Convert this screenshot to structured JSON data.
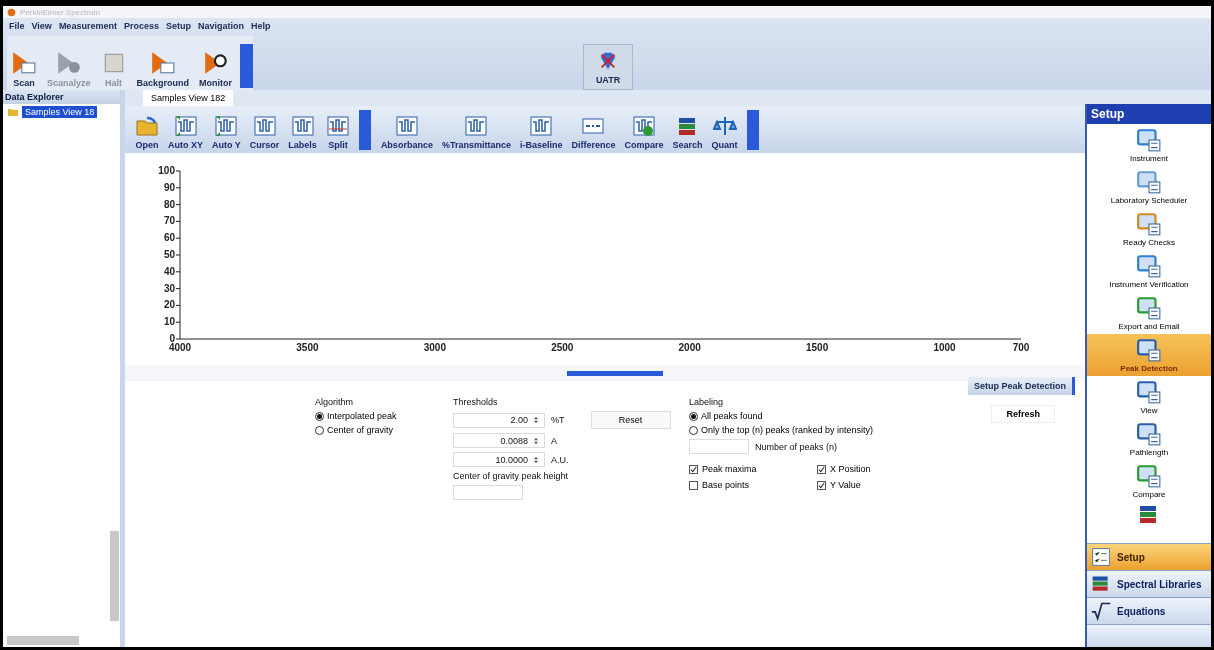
{
  "window": {
    "title": "PerkinElmer Spectrum"
  },
  "menu": [
    "File",
    "View",
    "Measurement",
    "Process",
    "Setup",
    "Navigation",
    "Help"
  ],
  "ribbon": {
    "buttons": [
      {
        "label": "Scan",
        "disabled": false
      },
      {
        "label": "Scanalyze",
        "disabled": true
      },
      {
        "label": "Halt",
        "disabled": true
      },
      {
        "label": "Background",
        "disabled": false
      },
      {
        "label": "Monitor",
        "disabled": false
      }
    ],
    "accessory": "UATR"
  },
  "data_explorer": {
    "title": "Data Explorer",
    "items": [
      {
        "label": "Samples View 18",
        "selected": true
      }
    ]
  },
  "tabs": [
    {
      "label": "Samples View 182",
      "selected": true
    }
  ],
  "toolbar": {
    "groups": [
      [
        "Open",
        "Auto XY",
        "Auto Y",
        "Cursor",
        "Labels",
        "Split"
      ],
      [
        "Absorbance",
        "%Transmittance",
        "i-Baseline",
        "Difference",
        "Compare",
        "Search",
        "Quant"
      ]
    ]
  },
  "chart_data": {
    "type": "line",
    "xlim": [
      4000,
      700
    ],
    "ylim": [
      0,
      100
    ],
    "xticks": [
      4000,
      3500,
      3000,
      2500,
      2000,
      1500,
      1000,
      700
    ],
    "yticks": [
      0,
      10,
      20,
      30,
      40,
      50,
      60,
      70,
      80,
      90,
      100
    ]
  },
  "peak_detection": {
    "algorithm": {
      "label": "Algorithm",
      "options": [
        {
          "label": "Interpolated peak",
          "selected": true
        },
        {
          "label": "Center of gravity",
          "selected": false
        }
      ]
    },
    "thresholds": {
      "label": "Thresholds",
      "fields": [
        {
          "value": "2.00",
          "unit": "%T"
        },
        {
          "value": "0.0088",
          "unit": "A"
        },
        {
          "value": "10.0000",
          "unit": "A.U."
        }
      ],
      "reset": "Reset",
      "gravity_label": "Center of gravity peak height"
    },
    "labeling": {
      "label": "Labeling",
      "options": [
        {
          "label": "All peaks found",
          "selected": true
        },
        {
          "label": "Only the top (n) peaks (ranked by intensity)",
          "selected": false
        }
      ],
      "count_label": "Number of peaks (n)",
      "checkboxes": [
        {
          "label": "Peak maxima",
          "checked": true
        },
        {
          "label": "X Position",
          "checked": true
        },
        {
          "label": "Base points",
          "checked": false
        },
        {
          "label": "Y Value",
          "checked": true
        }
      ]
    },
    "buttons": [
      "Setup Peak Detection",
      "Refresh"
    ]
  },
  "setup_panel": {
    "title": "Setup",
    "items": [
      {
        "label": "Instrument",
        "selected": false
      },
      {
        "label": "Laboratory Scheduler",
        "selected": false
      },
      {
        "label": "Ready Checks",
        "selected": false
      },
      {
        "label": "Instrument Verification",
        "selected": false
      },
      {
        "label": "Export and Email",
        "selected": false
      },
      {
        "label": "Peak Detection",
        "selected": true
      },
      {
        "label": "View",
        "selected": false
      },
      {
        "label": "Pathlength",
        "selected": false
      },
      {
        "label": "Compare",
        "selected": false
      }
    ],
    "nav": [
      {
        "label": "Setup",
        "selected": true
      },
      {
        "label": "Spectral Libraries",
        "selected": false
      },
      {
        "label": "Equations",
        "selected": false
      }
    ]
  }
}
